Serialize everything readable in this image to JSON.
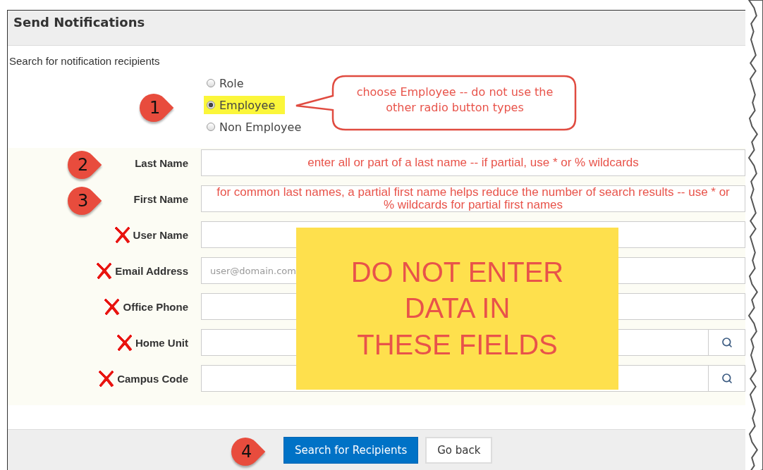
{
  "panel": {
    "title": "Send Notifications",
    "subtitle": "Search for notification recipients"
  },
  "recipient_types": [
    {
      "label": "Role",
      "selected": false,
      "highlighted": false
    },
    {
      "label": "Employee",
      "selected": true,
      "highlighted": true
    },
    {
      "label": "Non Employee",
      "selected": false,
      "highlighted": false
    }
  ],
  "radio_callout": {
    "step": "1",
    "text": "choose Employee -- do not use the other radio button types"
  },
  "fields": [
    {
      "label": "Last Name",
      "step": "2",
      "note": "enter all or part of a last name -- if partial, use * or % wildcards",
      "crossed": false,
      "lookup": false
    },
    {
      "label": "First Name",
      "step": "3",
      "note": "for common last names, a partial first name helps reduce the number of search results -- use * or % wildcards for partial first names",
      "crossed": false,
      "lookup": false
    },
    {
      "label": "User Name",
      "crossed": true,
      "lookup": false
    },
    {
      "label": "Email Address",
      "placeholder": "user@domain.com",
      "crossed": true,
      "lookup": false
    },
    {
      "label": "Office Phone",
      "crossed": true,
      "lookup": false
    },
    {
      "label": "Home Unit",
      "crossed": true,
      "lookup": true
    },
    {
      "label": "Campus Code",
      "crossed": true,
      "lookup": true
    }
  ],
  "warning_box": "DO NOT ENTER\nDATA IN\nTHESE FIELDS",
  "buttons": [
    {
      "label": "Search for Recipients",
      "kind": "primary",
      "step": "4"
    },
    {
      "label": "Go back",
      "kind": "default"
    }
  ]
}
